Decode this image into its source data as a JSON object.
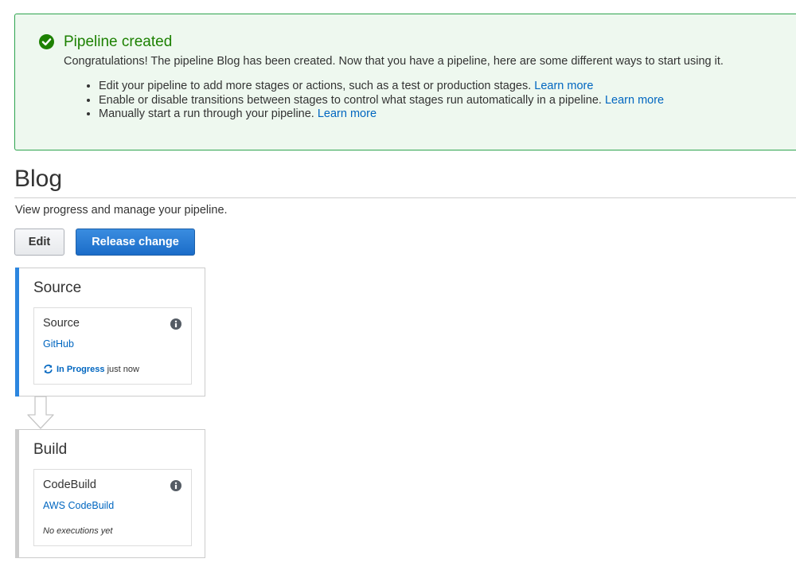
{
  "flash": {
    "title": "Pipeline created",
    "message": "Congratulations! The pipeline Blog has been created. Now that you have a pipeline, here are some different ways to start using it.",
    "icon": "check-circle-icon",
    "color": "#1d8102",
    "tips": [
      {
        "text": "Edit your pipeline to add more stages or actions, such as a test or production stages.",
        "link": "Learn more"
      },
      {
        "text": "Enable or disable transitions between stages to control what stages run automatically in a pipeline.",
        "link": "Learn more"
      },
      {
        "text": "Manually start a run through your pipeline.",
        "link": "Learn more"
      }
    ]
  },
  "page": {
    "title": "Blog",
    "description": "View progress and manage your pipeline."
  },
  "toolbar": {
    "edit_label": "Edit",
    "release_label": "Release change"
  },
  "stages": [
    {
      "name": "Source",
      "accent": "#2c86df",
      "action": {
        "name": "Source",
        "provider": "GitHub",
        "status": "In Progress",
        "status_time": "just now",
        "status_icon": "refresh-icon"
      }
    },
    {
      "name": "Build",
      "accent": "#cccccc",
      "action": {
        "name": "CodeBuild",
        "provider": "AWS CodeBuild",
        "status": "No executions yet"
      }
    }
  ]
}
